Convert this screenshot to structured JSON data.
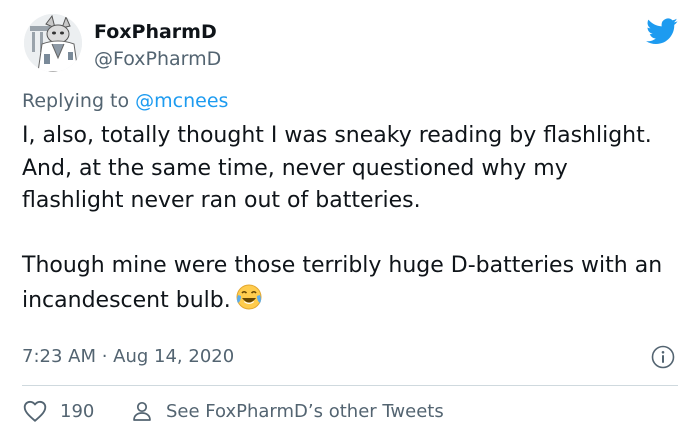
{
  "author": {
    "name": "FoxPharmD",
    "handle": "@FoxPharmD"
  },
  "reply": {
    "prefix": "Replying to",
    "handle": "@mcnees"
  },
  "tweet": {
    "line1": "I, also, totally thought I was sneaky reading by flashlight.",
    "line2": "And, at the same time, never questioned why my flashlight never ran out of batteries.",
    "line3": "Though mine were those terribly huge D-batteries with an incandescent bulb.",
    "emoji": "face-with-tears-of-joy"
  },
  "meta": {
    "timestamp": "7:23 AM · Aug 14, 2020"
  },
  "actions": {
    "like_count": "190",
    "other_tweets_label": "See FoxPharmD’s other Tweets"
  },
  "icons": {
    "brand": "twitter-bird-icon",
    "info": "info-icon",
    "like": "heart-icon",
    "profile": "person-icon"
  },
  "colors": {
    "twitter_blue": "#1d9bf0",
    "text_primary": "#0f1419",
    "text_secondary": "#536471",
    "divider": "#cfd9de"
  }
}
